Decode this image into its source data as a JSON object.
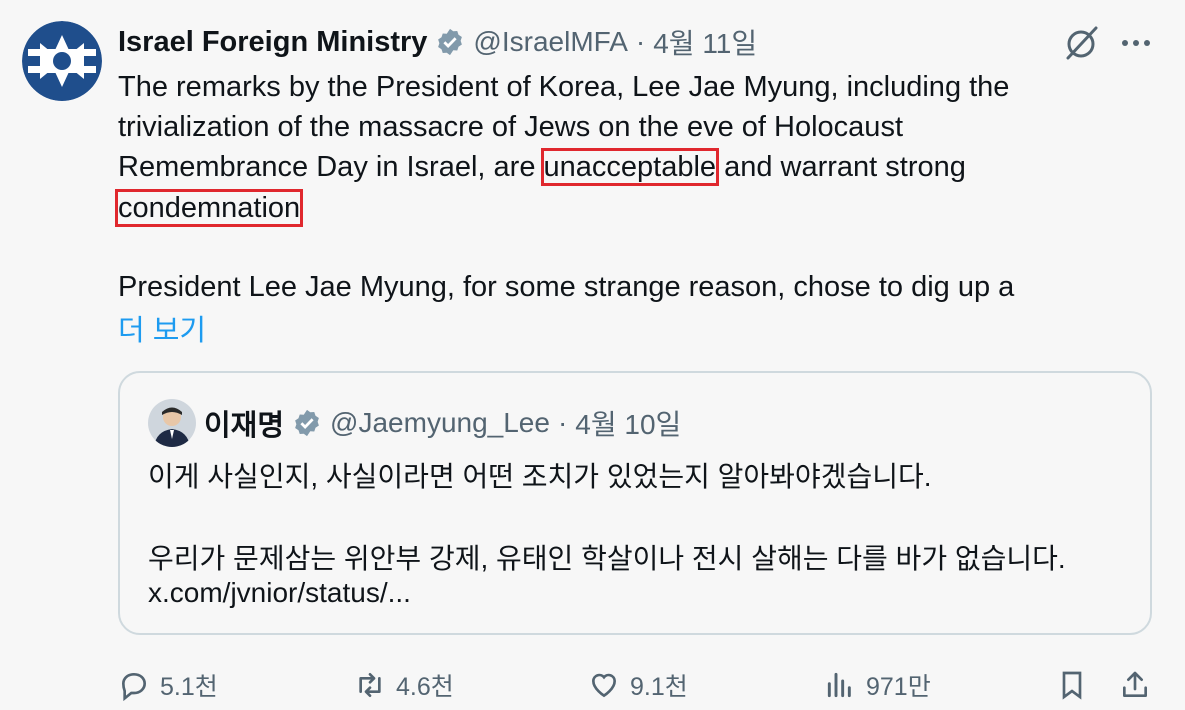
{
  "tweet": {
    "author_name": "Israel Foreign Ministry",
    "handle": "@IsraelMFA",
    "separator": "·",
    "date": "4월 11일",
    "lines": [
      "The remarks by the President of Korea, Lee Jae Myung, including the",
      "trivialization of the massacre of Jews on the eve of Holocaust"
    ],
    "line3_pre": "Remembrance Day in Israel, are ",
    "line3_highlight": "unacceptable",
    "line3_post": " and warrant strong",
    "line4_highlight": "condemnation",
    "paragraph2": "President Lee Jae Myung, for some strange reason, chose to dig up a",
    "show_more": "더 보기"
  },
  "quote": {
    "author_name": "이재명",
    "handle": "@Jaemyung_Lee",
    "separator": "·",
    "date": "4월 10일",
    "line1": "이게 사실인지, 사실이라면 어떤 조치가 있었는지 알아봐야겠습니다.",
    "line2": "우리가 문제삼는 위안부 강제, 유태인 학살이나 전시 살해는 다를 바가 없습니다.",
    "link": "x.com/jvnior/status/..."
  },
  "actions": {
    "replies": "5.1천",
    "reposts": "4.6천",
    "likes": "9.1천",
    "views": "971만"
  },
  "colors": {
    "accent": "#1d9bf0",
    "highlight_box": "#e0282e",
    "secondary_text": "#536471",
    "logo_blue": "#1f4e8c"
  },
  "icons": [
    "grok-icon",
    "more-icon",
    "reply-icon",
    "repost-icon",
    "like-icon",
    "views-icon",
    "bookmark-icon",
    "share-icon",
    "verified-icon"
  ]
}
